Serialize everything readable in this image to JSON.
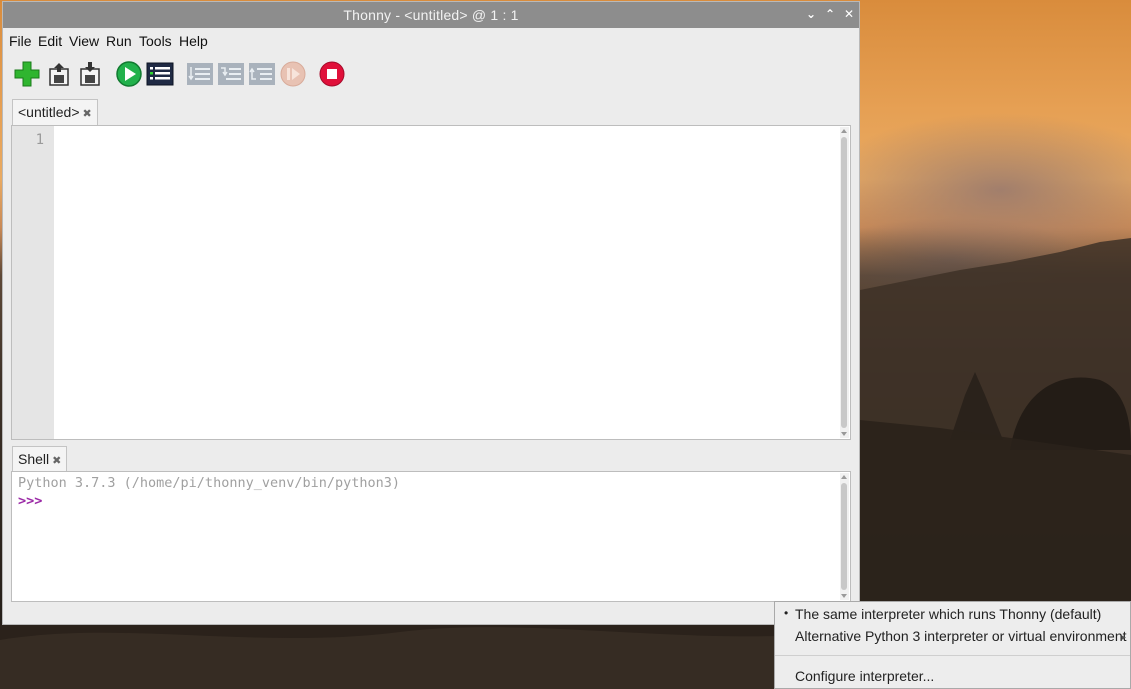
{
  "window": {
    "title": "Thonny  -  <untitled>  @  1 : 1",
    "controls": {
      "minimize": "⌄",
      "maximize": "⌃",
      "close": "✕"
    }
  },
  "menubar": {
    "items": [
      "File",
      "Edit",
      "View",
      "Run",
      "Tools",
      "Help"
    ]
  },
  "toolbar": {
    "buttons": [
      {
        "icon": "new-file-icon",
        "enabled": true
      },
      {
        "icon": "open-file-icon",
        "enabled": true
      },
      {
        "icon": "save-file-icon",
        "enabled": true
      },
      {
        "icon": "run-icon",
        "enabled": true
      },
      {
        "icon": "debug-icon",
        "enabled": true
      },
      {
        "icon": "step-over-icon",
        "enabled": false
      },
      {
        "icon": "step-into-icon",
        "enabled": false
      },
      {
        "icon": "step-out-icon",
        "enabled": false
      },
      {
        "icon": "resume-icon",
        "enabled": false
      },
      {
        "icon": "stop-icon",
        "enabled": true
      }
    ]
  },
  "editor": {
    "tab_label": "<untitled>",
    "tab_close": "✖",
    "line_numbers": [
      "1"
    ]
  },
  "shell": {
    "tab_label": "Shell",
    "tab_close": "✖",
    "banner": "Python 3.7.3 (/home/pi/thonny_venv/bin/python3)",
    "prompt": ">>>"
  },
  "interpreter_menu": {
    "items": [
      {
        "label": "The same interpreter which runs Thonny (default)",
        "bullet": "•"
      },
      {
        "label": "Alternative Python 3 interpreter or virtual environment",
        "submenu_arrow": "▸"
      },
      {
        "label": "Configure interpreter..."
      }
    ]
  },
  "colors": {
    "titlebar": "#8d8d8d",
    "prompt": "#9b2aa6",
    "banner": "#a0a0a0",
    "run_green": "#22b14c",
    "stop_red": "#e0103a"
  }
}
